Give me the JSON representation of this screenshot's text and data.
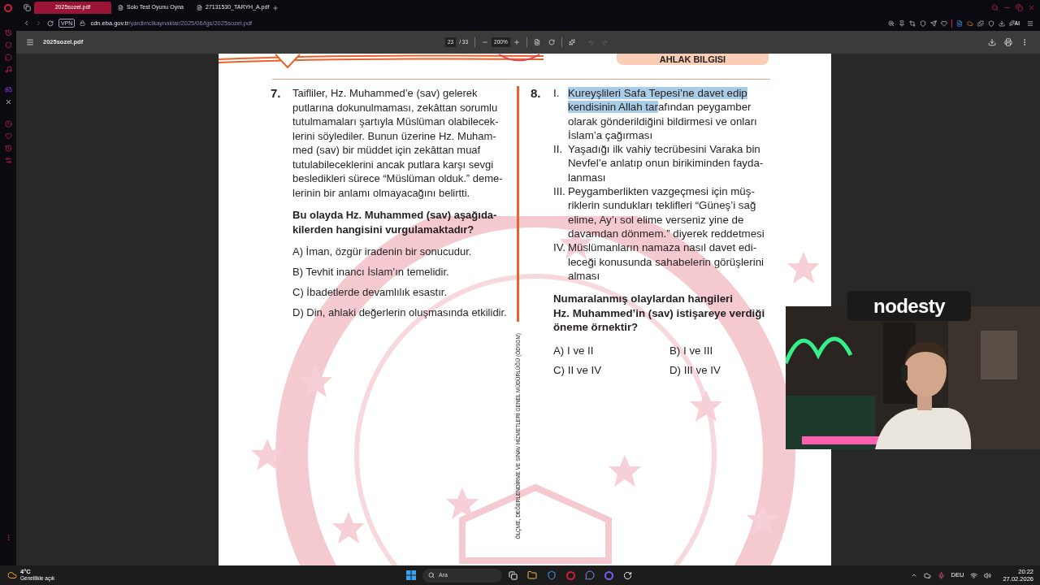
{
  "browser": {
    "tabs": [
      {
        "label": "2025sozel.pdf",
        "selected": true
      },
      {
        "label": "Solo Test Oyunu Oyna",
        "selected": false
      },
      {
        "label": "27131530_TARYH_A.pdf",
        "selected": false
      }
    ],
    "vpn": "VPN",
    "url_host": "cdn.eba.gov.tr",
    "url_path": "/yardimcikaynaklar/2025/06/lgs/2025sozel.pdf",
    "ai_label": "AI"
  },
  "pdf_toolbar": {
    "title": "2025sozel.pdf",
    "page": "23",
    "page_count": "/ 33",
    "zoom": "200%"
  },
  "page": {
    "header_label": "AHLAK BILGISI",
    "side_text": "ÖLÇME, DEĞERLENDİRME VE SINAV HİZMETLERİ GENEL MÜDÜRLÜĞÜ (ÖDSGM)",
    "question_7": {
      "number": "7.",
      "text": "Taifliler, Hz. Muhammed’e (sav) gelerek\nputlarına dokunulmaması, zekâttan sorumlu\ntutulmamaları şartıyla Müslüman olabilecek-\nlerini söylediler. Bunun üzerine Hz. Muham-\nmed (sav) bir müddet için zekâttan muaf\ntutulabileceklerini ancak putlara karşı sevgi\nbesledikleri sürece “Müslüman olduk.” deme-\nlerinin bir anlamı olmayacağını belirtti.",
      "prompt": "Bu olayda Hz. Muhammed (sav) aşağıda-\nkilerden hangisini vurgulamaktadır?",
      "options": [
        "A) İman, özgür iradenin bir sonucudur.",
        "B) Tevhit inancı İslam’ın temelidir.",
        "C) İbadetlerde devamlılık esastır.",
        "D) Din, ahlaki değerlerin oluşmasında etkilidir."
      ]
    },
    "question_8": {
      "number": "8.",
      "items": [
        {
          "numeral": "I.",
          "segments": [
            {
              "text": "Kureyşlileri Safa Tepesi’ne davet edip\nkendisinin Allah tar",
              "selected": true
            },
            {
              "text": "afından peygamber\nolarak gönderildiğini bildirmesi ve onları\nİslam’a çağırması",
              "selected": false
            }
          ]
        },
        {
          "numeral": "II.",
          "segments": [
            {
              "text": "Yaşadığı ilk vahiy tecrübesini Varaka bin\nNevfel’e anlatıp onun birikiminden fayda-\nlanması",
              "selected": false
            }
          ]
        },
        {
          "numeral": "III.",
          "segments": [
            {
              "text": "Peygamberlikten vazgeçmesi için müş-\nriklerin sundukları teklifleri “Güneş’i sağ\nelime, Ay’ı sol elime verseniz yine de\ndavamdan dönmem.” diyerek reddetmesi",
              "selected": false
            }
          ]
        },
        {
          "numeral": "IV.",
          "segments": [
            {
              "text": "Müslümanların namaza nasıl davet edi-\nleceği konusunda sahabelerin görüşlerini\nalması",
              "selected": false
            }
          ]
        }
      ],
      "prompt": "Numaralanmış olaylardan hangileri\nHz. Muhammed’in (sav) istişareye verdiği\nöneme örnektir?",
      "options": [
        "A) I ve II",
        "B) I ve III",
        "C) II ve IV",
        "D) III ve IV"
      ]
    }
  },
  "overlay": {
    "logo": "nodesty"
  },
  "taskbar": {
    "weather_temp": "4°C",
    "weather_text": "Genellikle açık",
    "search_placeholder": "Ara",
    "language": "DEU",
    "time": "20:22",
    "date": "27.02.2026"
  }
}
